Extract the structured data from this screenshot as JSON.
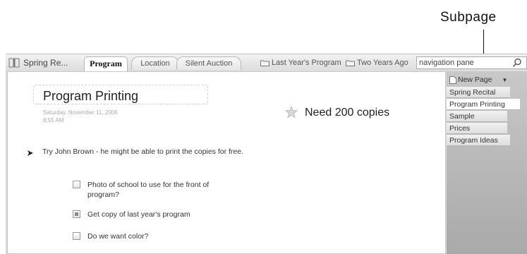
{
  "callout": {
    "label": "Subpage"
  },
  "notebook": {
    "name": "Spring Re..."
  },
  "tabs": [
    {
      "label": "Program",
      "active": true
    },
    {
      "label": "Location",
      "active": false
    },
    {
      "label": "Silent Auction",
      "active": false
    }
  ],
  "section_links": [
    {
      "label": "Last Year's Program"
    },
    {
      "label": "Two Years Ago"
    }
  ],
  "search": {
    "value": "navigation pane"
  },
  "page": {
    "title": "Program Printing",
    "date": "Saturday, November 11, 2006",
    "time": "8:55 AM",
    "note": "Need 200 copies",
    "bullet": "Try John Brown - he might be able to print the copies for free.",
    "todos": [
      {
        "text": "Photo of school to use for the front of program?",
        "checked": false
      },
      {
        "text": "Get copy of last year's program",
        "checked": true
      },
      {
        "text": "Do we want color?",
        "checked": false
      }
    ]
  },
  "pane": {
    "new_page": "New Page",
    "items": [
      {
        "label": "Spring Recital",
        "current": false
      },
      {
        "label": "Program Printing",
        "current": true
      },
      {
        "label": "Sample",
        "current": false
      },
      {
        "label": "Prices",
        "current": false
      },
      {
        "label": "Program Ideas",
        "current": false
      }
    ]
  }
}
